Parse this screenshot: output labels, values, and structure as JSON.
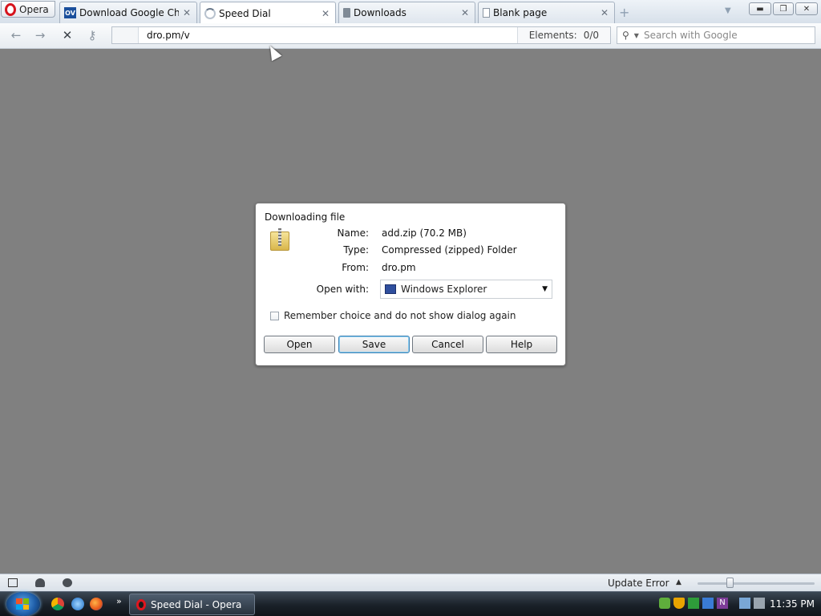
{
  "browser": {
    "opera_label": "Opera",
    "tabs": [
      {
        "label": "Download Google Chr...",
        "icon": "ov-site-icon"
      },
      {
        "label": "Speed Dial",
        "icon": "loading-spinner-icon"
      },
      {
        "label": "Downloads",
        "icon": "downloads-icon"
      },
      {
        "label": "Blank page",
        "icon": "blank-page-icon"
      }
    ],
    "new_tab_symbol": "+",
    "close_symbol": "✕",
    "address": {
      "url": "dro.pm/v",
      "elements_label": "Elements:",
      "elements_value": "0/0"
    },
    "search": {
      "placeholder": "Search with Google"
    }
  },
  "dialog": {
    "title": "Downloading file",
    "name_label": "Name:",
    "name_value": "add.zip (70.2 MB)",
    "type_label": "Type:",
    "type_value": "Compressed (zipped) Folder",
    "from_label": "From:",
    "from_value": "dro.pm",
    "open_with_label": "Open with:",
    "open_with_value": "Windows Explorer",
    "remember_label": "Remember choice and do not show dialog again",
    "buttons": {
      "open": "Open",
      "save": "Save",
      "cancel": "Cancel",
      "help": "Help"
    }
  },
  "statusbar": {
    "update_text": "Update Error"
  },
  "taskbar": {
    "task_label": "Speed Dial - Opera",
    "clock": "11:35 PM",
    "overflow": "»"
  },
  "colors": {
    "content_bg": "#808080",
    "opera_red": "#d6141d"
  }
}
